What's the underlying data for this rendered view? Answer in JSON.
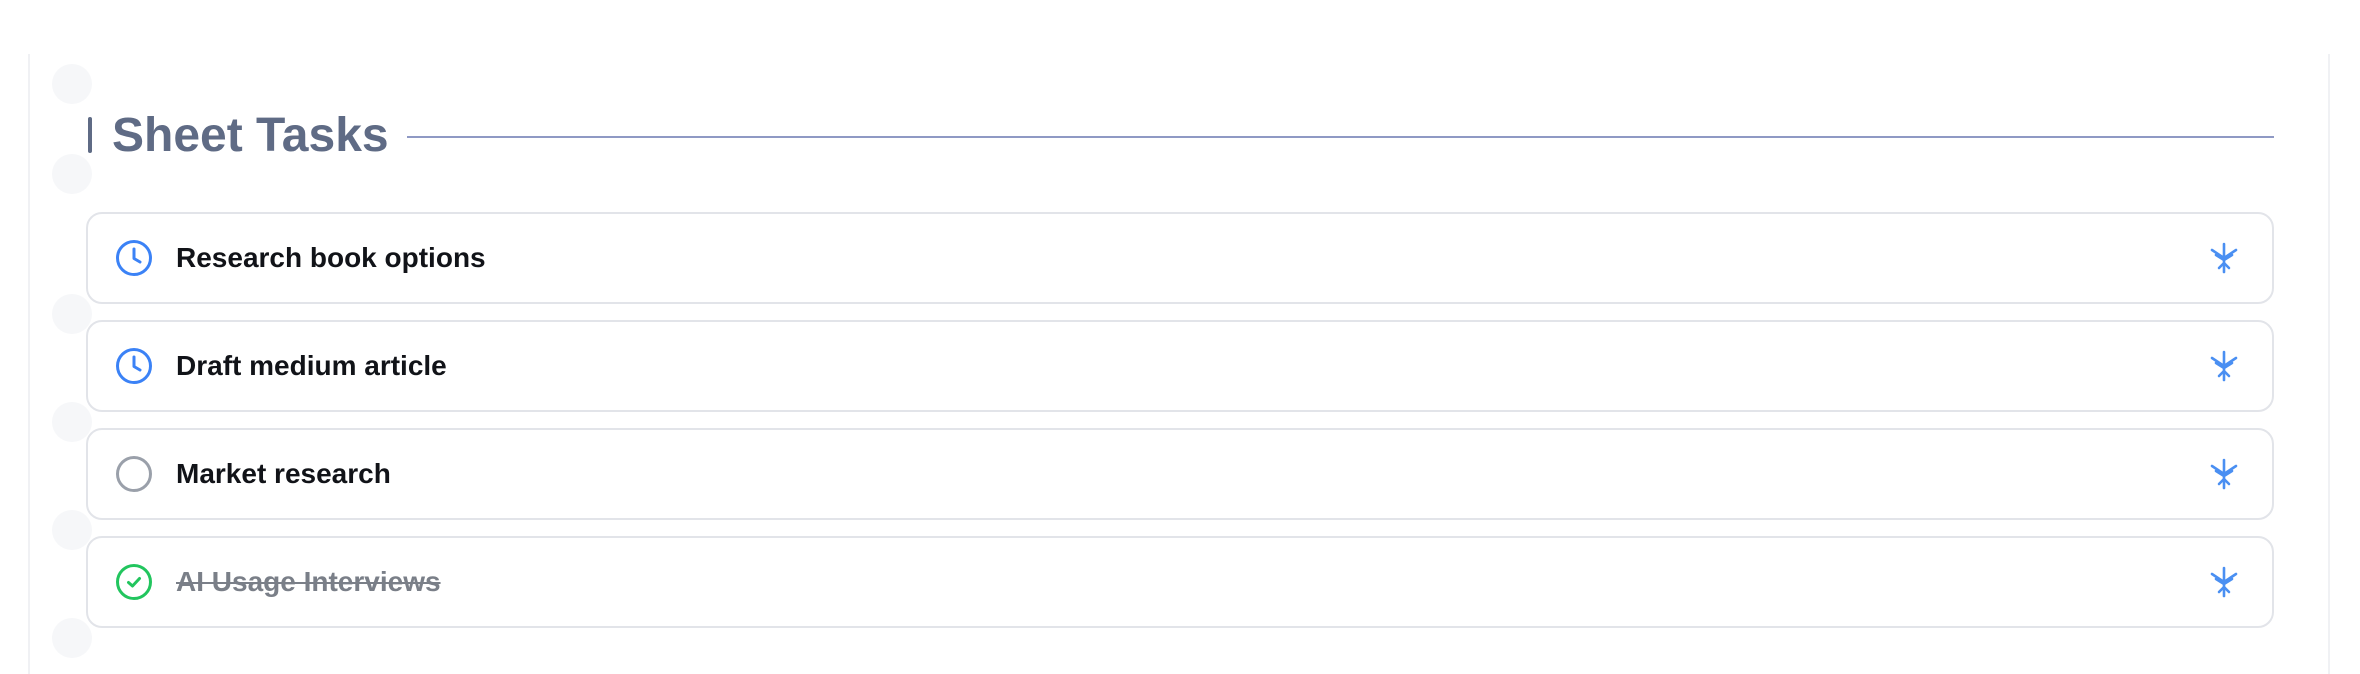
{
  "section": {
    "title": "Sheet Tasks"
  },
  "tasks": [
    {
      "label": "Research book options",
      "status": "in-progress",
      "status_icon": "clock-icon",
      "action_icon": "ai-sparkle-icon"
    },
    {
      "label": "Draft medium article",
      "status": "in-progress",
      "status_icon": "clock-icon",
      "action_icon": "ai-sparkle-icon"
    },
    {
      "label": "Market research",
      "status": "not-started",
      "status_icon": "empty-circle-icon",
      "action_icon": "ai-sparkle-icon"
    },
    {
      "label": "AI Usage Interviews",
      "status": "completed",
      "status_icon": "check-circle-icon",
      "action_icon": "ai-sparkle-icon"
    }
  ],
  "colors": {
    "header_text": "#5f6b85",
    "header_line": "#8f99c4",
    "in_progress": "#3b82f6",
    "not_started": "#9aa0aa",
    "completed": "#22c55e",
    "action_icon": "#4a8ff2",
    "task_border": "#e2e4e9"
  }
}
